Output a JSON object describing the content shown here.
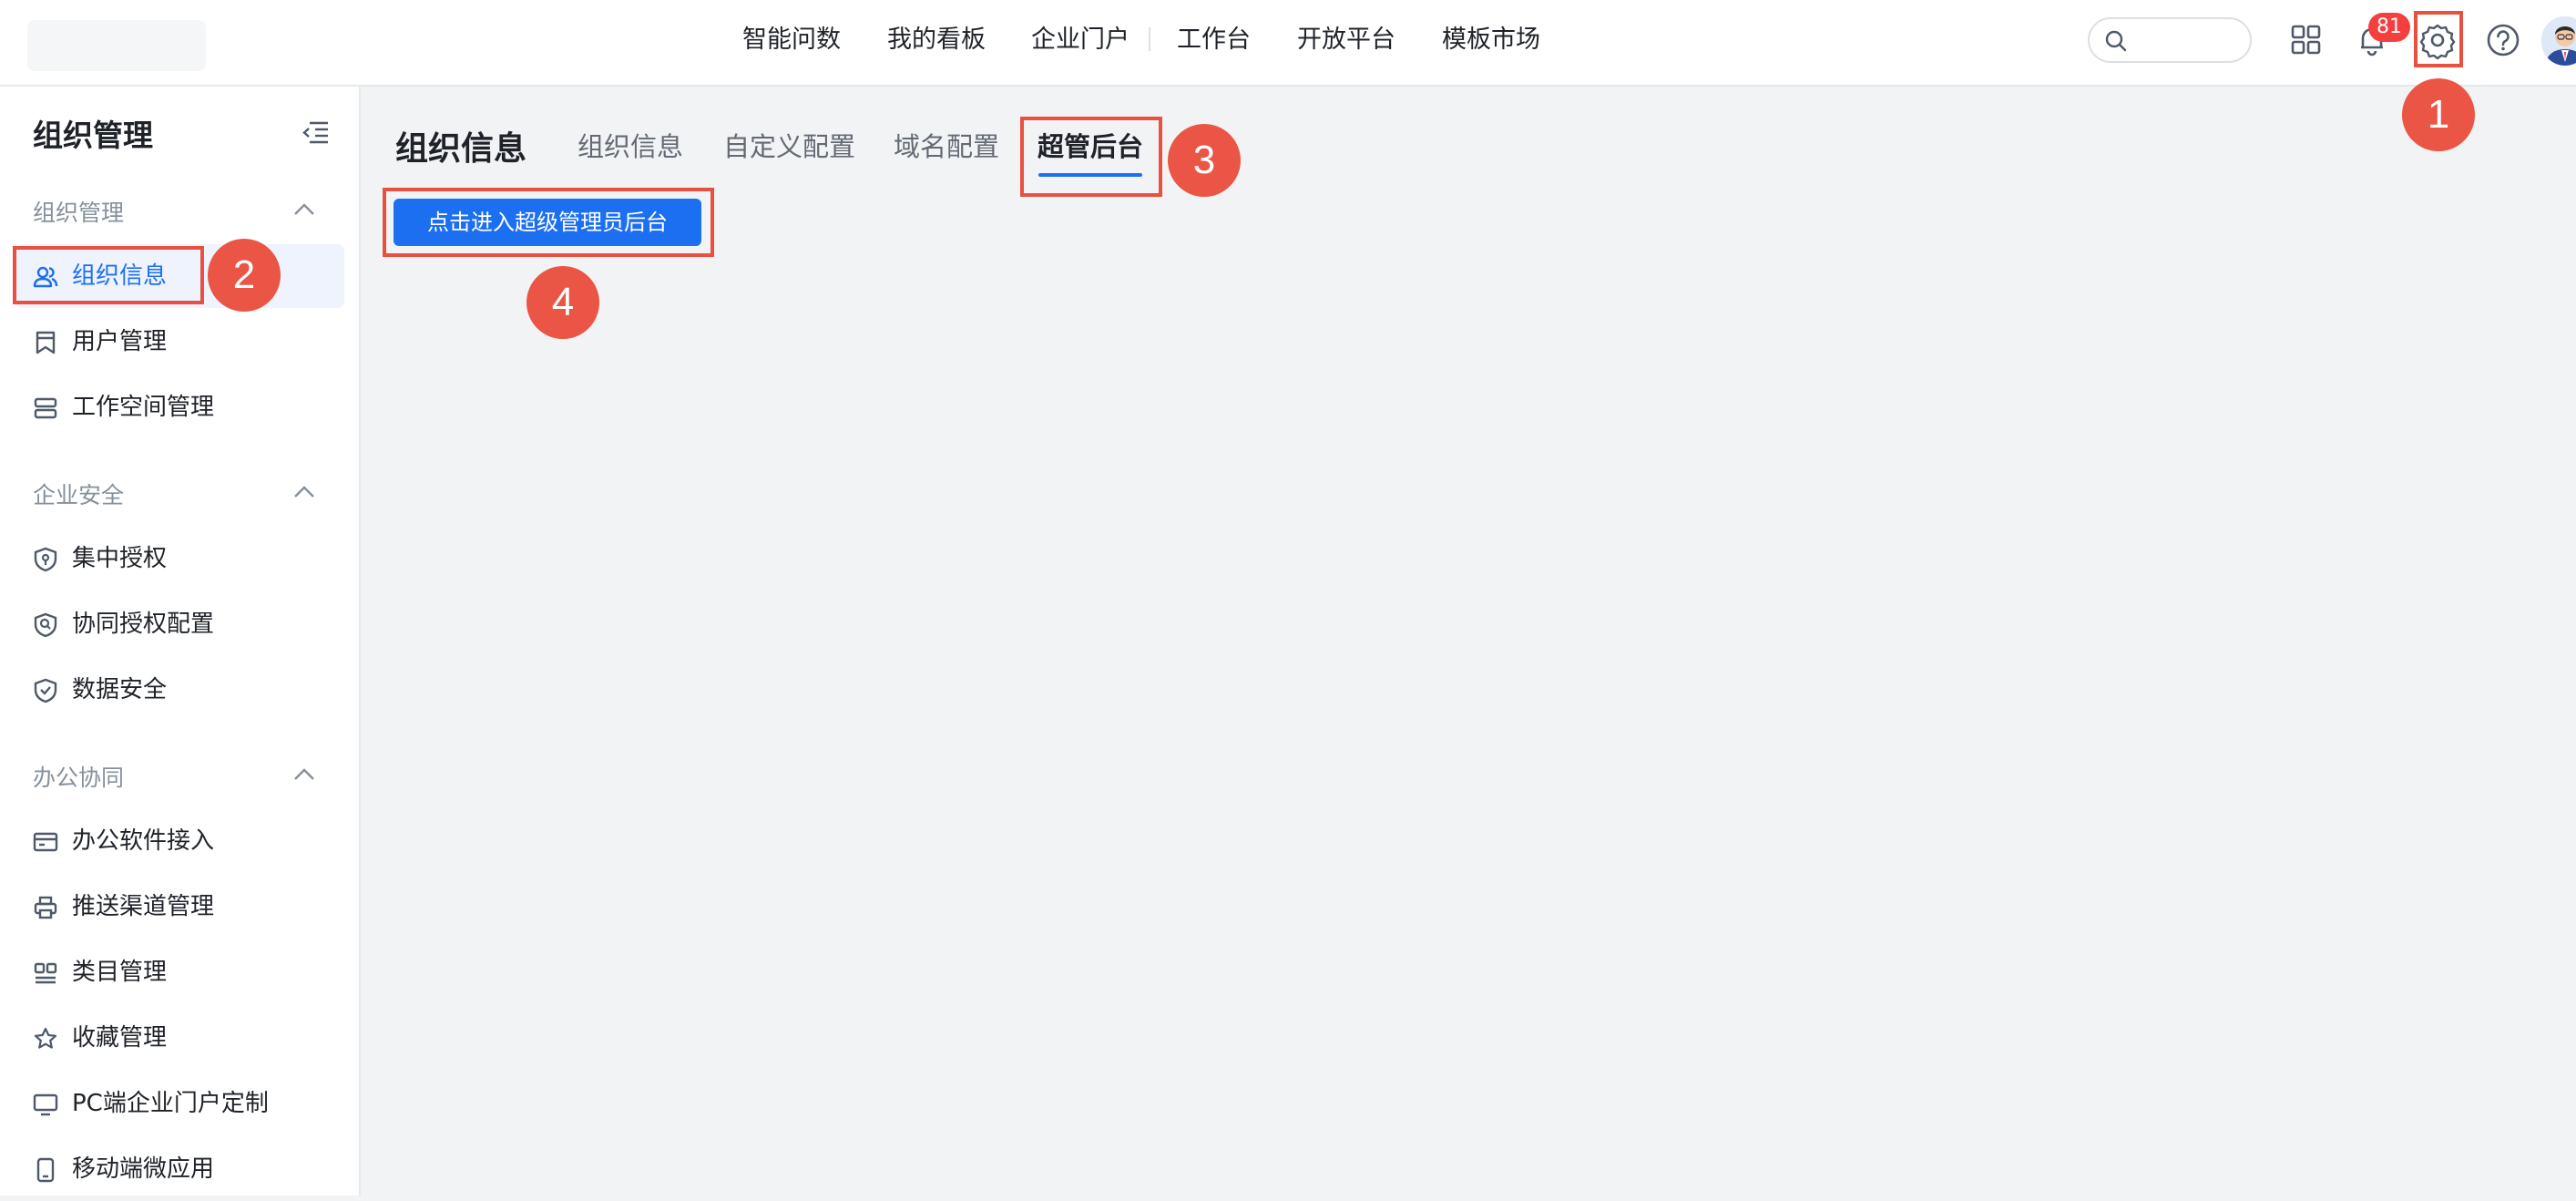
{
  "top_nav": {
    "items": [
      {
        "label": "智能问数"
      },
      {
        "label": "我的看板"
      },
      {
        "label": "企业门户"
      },
      {
        "label": "工作台"
      },
      {
        "label": "开放平台"
      },
      {
        "label": "模板市场"
      }
    ],
    "search": {
      "placeholder": "",
      "icon": "search-icon"
    },
    "icons": [
      "apps-grid-icon",
      "bell-icon",
      "gear-icon",
      "help-icon"
    ],
    "notification_count": "81",
    "accent_color": "#1d6ff2",
    "badge_color": "#f53f3f"
  },
  "sidebar": {
    "title": "组织管理",
    "groups": [
      {
        "title": "组织管理",
        "items": [
          {
            "label": "组织信息",
            "icon": "users-icon",
            "active": true
          },
          {
            "label": "用户管理",
            "icon": "bookmark-icon"
          },
          {
            "label": "工作空间管理",
            "icon": "server-icon"
          }
        ]
      },
      {
        "title": "企业安全",
        "items": [
          {
            "label": "集中授权",
            "icon": "shield-icon"
          },
          {
            "label": "协同授权配置",
            "icon": "shield-search-icon"
          },
          {
            "label": "数据安全",
            "icon": "shield-check-icon"
          }
        ]
      },
      {
        "title": "办公协同",
        "items": [
          {
            "label": "办公软件接入",
            "icon": "card-icon"
          },
          {
            "label": "推送渠道管理",
            "icon": "printer-icon"
          },
          {
            "label": "类目管理",
            "icon": "category-icon"
          },
          {
            "label": "收藏管理",
            "icon": "star-icon"
          },
          {
            "label": "PC端企业门户定制",
            "icon": "monitor-icon"
          },
          {
            "label": "移动端微应用",
            "icon": "mobile-icon"
          }
        ]
      }
    ]
  },
  "main": {
    "page_title": "组织信息",
    "tabs": [
      {
        "label": "组织信息"
      },
      {
        "label": "自定义配置"
      },
      {
        "label": "域名配置"
      },
      {
        "label": "超管后台",
        "active": true
      }
    ],
    "enter_button_label": "点击进入超级管理员后台"
  },
  "annotations": {
    "markers": [
      "1",
      "2",
      "3",
      "4"
    ],
    "color": "#ea5545"
  }
}
